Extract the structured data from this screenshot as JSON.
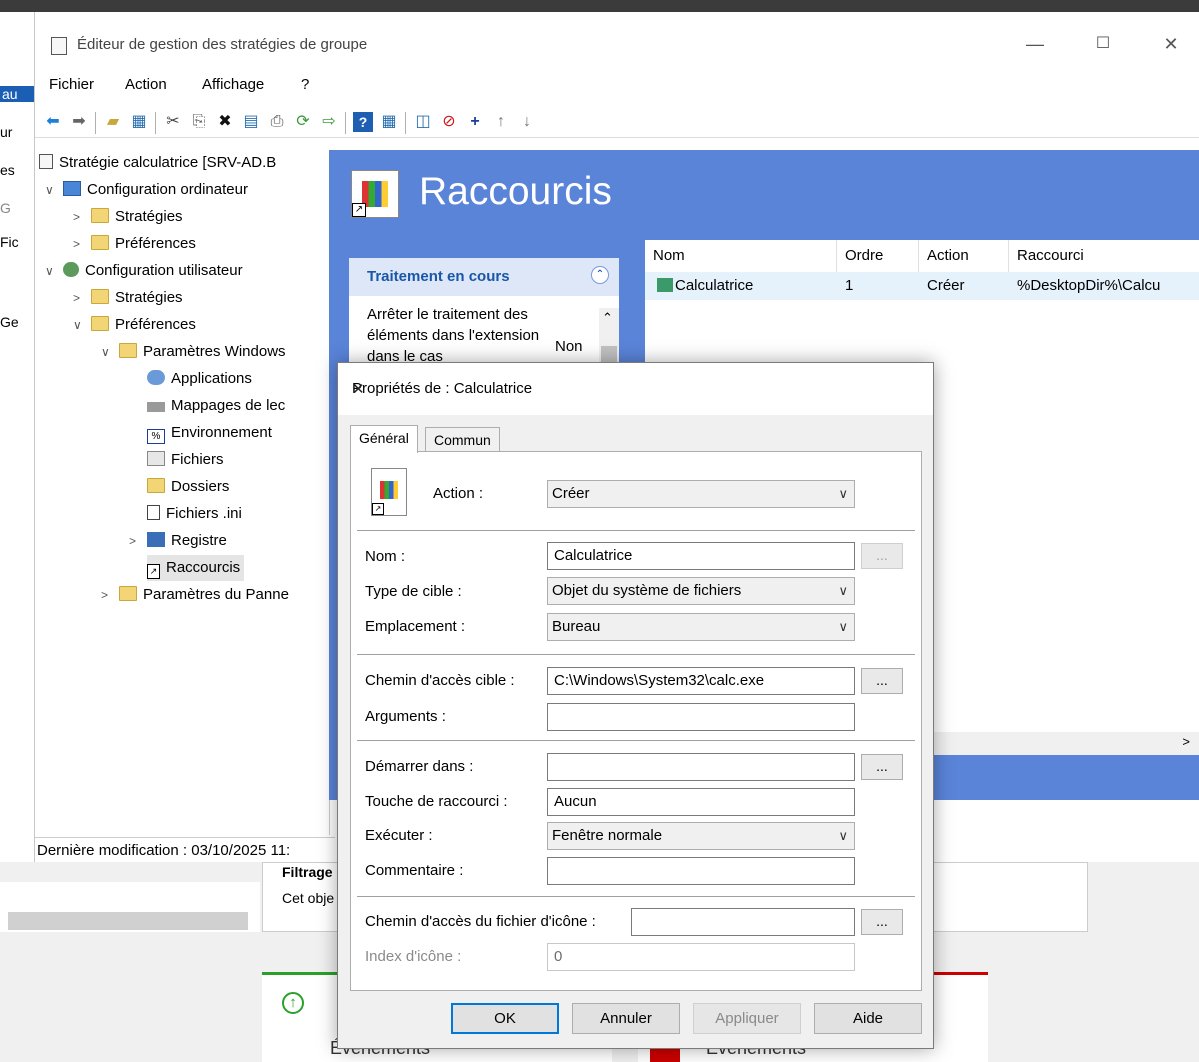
{
  "background_app": {
    "fragments": [
      "au",
      "ur",
      "es",
      "G",
      "Fic",
      "Ge"
    ],
    "bottom_items": [
      "Événements",
      "Événements"
    ],
    "filter_label": "Filtrage",
    "object_text": "Cet obje"
  },
  "window": {
    "title": "Éditeur de gestion des stratégies de groupe",
    "menu": [
      "Fichier",
      "Action",
      "Affichage",
      "?"
    ],
    "tree": [
      {
        "label": "Stratégie calculatrice [SRV-AD.B",
        "level": 0,
        "chev": ""
      },
      {
        "label": "Configuration ordinateur",
        "level": 1,
        "chev": "v"
      },
      {
        "label": "Stratégies",
        "level": 2,
        "chev": ">"
      },
      {
        "label": "Préférences",
        "level": 2,
        "chev": ">"
      },
      {
        "label": "Configuration utilisateur",
        "level": 1,
        "chev": "v"
      },
      {
        "label": "Stratégies",
        "level": 2,
        "chev": ">"
      },
      {
        "label": "Préférences",
        "level": 2,
        "chev": "v"
      },
      {
        "label": "Paramètres Windows",
        "level": 3,
        "chev": "v"
      },
      {
        "label": "Applications",
        "level": 4,
        "chev": ""
      },
      {
        "label": "Mappages de lec",
        "level": 4,
        "chev": ""
      },
      {
        "label": "Environnement",
        "level": 4,
        "chev": ""
      },
      {
        "label": "Fichiers",
        "level": 4,
        "chev": ""
      },
      {
        "label": "Dossiers",
        "level": 4,
        "chev": ""
      },
      {
        "label": "Fichiers .ini",
        "level": 4,
        "chev": ""
      },
      {
        "label": "Registre",
        "level": 4,
        "chev": ">"
      },
      {
        "label": "Raccourcis",
        "level": 4,
        "chev": ""
      },
      {
        "label": "Paramètres du Panne",
        "level": 3,
        "chev": ">"
      }
    ],
    "status": "Dernière modification : 03/10/2025 11:",
    "pane_title": "Raccourcis",
    "task_header": "Traitement en cours",
    "task_text": "Arrêter le traitement des éléments dans l'extension dans le cas",
    "task_value": "Non",
    "list_headers": [
      "Nom",
      "Ordre",
      "Action",
      "Raccourci"
    ],
    "list_rows": [
      {
        "nom": "Calculatrice",
        "ordre": "1",
        "action": "Créer",
        "raccourci": "%DesktopDir%\\Calcu"
      }
    ]
  },
  "dialog": {
    "title": "Propriétés de : Calculatrice",
    "tabs": [
      "Général",
      "Commun"
    ],
    "action_label": "Action :",
    "action_value": "Créer",
    "nom_label": "Nom :",
    "nom_value": "Calculatrice",
    "type_label": "Type de cible :",
    "type_value": "Objet du système de fichiers",
    "emplacement_label": "Emplacement :",
    "emplacement_value": "Bureau",
    "chemin_label": "Chemin d'accès cible :",
    "chemin_value": "C:\\Windows\\System32\\calc.exe",
    "arguments_label": "Arguments :",
    "arguments_value": "",
    "demarrer_label": "Démarrer dans :",
    "demarrer_value": "",
    "touche_label": "Touche de raccourci :",
    "touche_value": "Aucun",
    "executer_label": "Exécuter :",
    "executer_value": "Fenêtre normale",
    "commentaire_label": "Commentaire :",
    "commentaire_value": "",
    "icone_label": "Chemin d'accès du fichier d'icône :",
    "icone_value": "",
    "index_label": "Index d'icône :",
    "index_value": "0",
    "ellipsis": "...",
    "buttons": {
      "ok": "OK",
      "annuler": "Annuler",
      "appliquer": "Appliquer",
      "aide": "Aide"
    }
  }
}
